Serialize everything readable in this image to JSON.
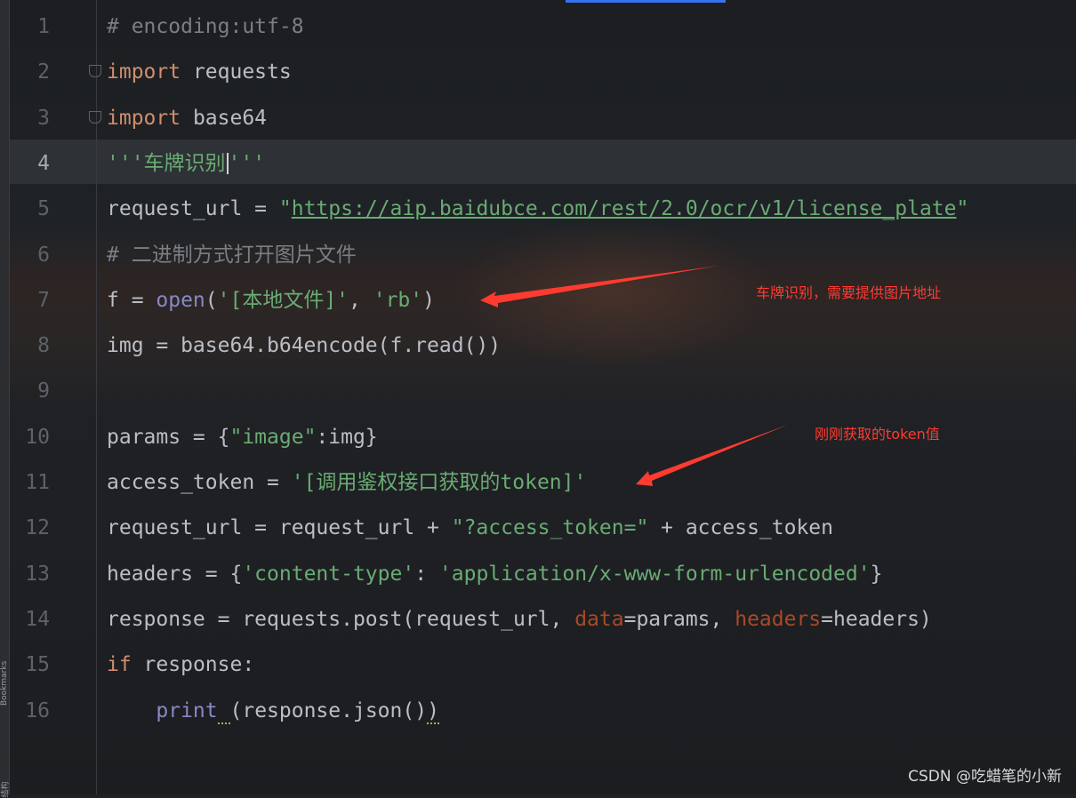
{
  "editor": {
    "lines": [
      {
        "n": "1",
        "tokens": [
          {
            "t": "cmt",
            "v": "# encoding:utf-8"
          }
        ]
      },
      {
        "n": "2",
        "tokens": [
          {
            "t": "kw",
            "v": "import"
          },
          {
            "t": "",
            "v": " requests"
          }
        ]
      },
      {
        "n": "3",
        "tokens": [
          {
            "t": "kw",
            "v": "import"
          },
          {
            "t": "",
            "v": " base64"
          }
        ]
      },
      {
        "n": "4",
        "tokens": [
          {
            "t": "str",
            "v": "'''车牌识别"
          },
          {
            "t": "caret",
            "v": ""
          },
          {
            "t": "str",
            "v": "'''"
          }
        ]
      },
      {
        "n": "5",
        "tokens": [
          {
            "t": "",
            "v": "request_url = "
          },
          {
            "t": "str",
            "v": "\""
          },
          {
            "t": "str url",
            "v": "https://aip.baidubce.com/rest/2.0/ocr/v1/license_plate"
          },
          {
            "t": "str",
            "v": "\""
          }
        ]
      },
      {
        "n": "6",
        "tokens": [
          {
            "t": "cmt",
            "v": "# 二进制方式打开图片文件"
          }
        ]
      },
      {
        "n": "7",
        "tokens": [
          {
            "t": "",
            "v": "f = "
          },
          {
            "t": "bi",
            "v": "open"
          },
          {
            "t": "",
            "v": "("
          },
          {
            "t": "str",
            "v": "'[本地文件]'"
          },
          {
            "t": "",
            "v": ", "
          },
          {
            "t": "str",
            "v": "'rb'"
          },
          {
            "t": "",
            "v": ")"
          }
        ]
      },
      {
        "n": "8",
        "tokens": [
          {
            "t": "",
            "v": "img = base64.b64encode(f.read())"
          }
        ]
      },
      {
        "n": "9",
        "tokens": []
      },
      {
        "n": "10",
        "tokens": [
          {
            "t": "",
            "v": "params = {"
          },
          {
            "t": "str",
            "v": "\"image\""
          },
          {
            "t": "",
            "v": ":img}"
          }
        ]
      },
      {
        "n": "11",
        "tokens": [
          {
            "t": "",
            "v": "access_token = "
          },
          {
            "t": "str",
            "v": "'[调用鉴权接口获取的token]'"
          }
        ]
      },
      {
        "n": "12",
        "tokens": [
          {
            "t": "",
            "v": "request_url = request_url + "
          },
          {
            "t": "str",
            "v": "\"?access_token=\""
          },
          {
            "t": "",
            "v": " + access_token"
          }
        ]
      },
      {
        "n": "13",
        "tokens": [
          {
            "t": "",
            "v": "headers = {"
          },
          {
            "t": "str",
            "v": "'content-type'"
          },
          {
            "t": "",
            "v": ": "
          },
          {
            "t": "str",
            "v": "'application/x-www-form-urlencoded'"
          },
          {
            "t": "",
            "v": "}"
          }
        ]
      },
      {
        "n": "14",
        "tokens": [
          {
            "t": "",
            "v": "response = requests.post(request_url, "
          },
          {
            "t": "par",
            "v": "data"
          },
          {
            "t": "",
            "v": "=params, "
          },
          {
            "t": "par",
            "v": "headers"
          },
          {
            "t": "",
            "v": "=headers)"
          }
        ]
      },
      {
        "n": "15",
        "tokens": [
          {
            "t": "kw",
            "v": "if"
          },
          {
            "t": "",
            "v": " response:"
          }
        ]
      },
      {
        "n": "16",
        "tokens": [
          {
            "t": "",
            "v": "    "
          },
          {
            "t": "bi",
            "v": "print"
          },
          {
            "t": "squiggle",
            "v": " "
          },
          {
            "t": "",
            "v": "(response.json()"
          },
          {
            "t": "squiggle",
            "v": ")"
          }
        ]
      }
    ],
    "active_line": "4"
  },
  "annotations": {
    "arrow_1_text": "车牌识别，需要提供图片地址",
    "arrow_2_text": "刚刚获取的token值",
    "arrow_color": "#ff3b30"
  },
  "side_strip": {
    "labels": [
      "Bookmarks",
      "结构"
    ]
  },
  "watermark": "CSDN @吃蜡笔的小新"
}
